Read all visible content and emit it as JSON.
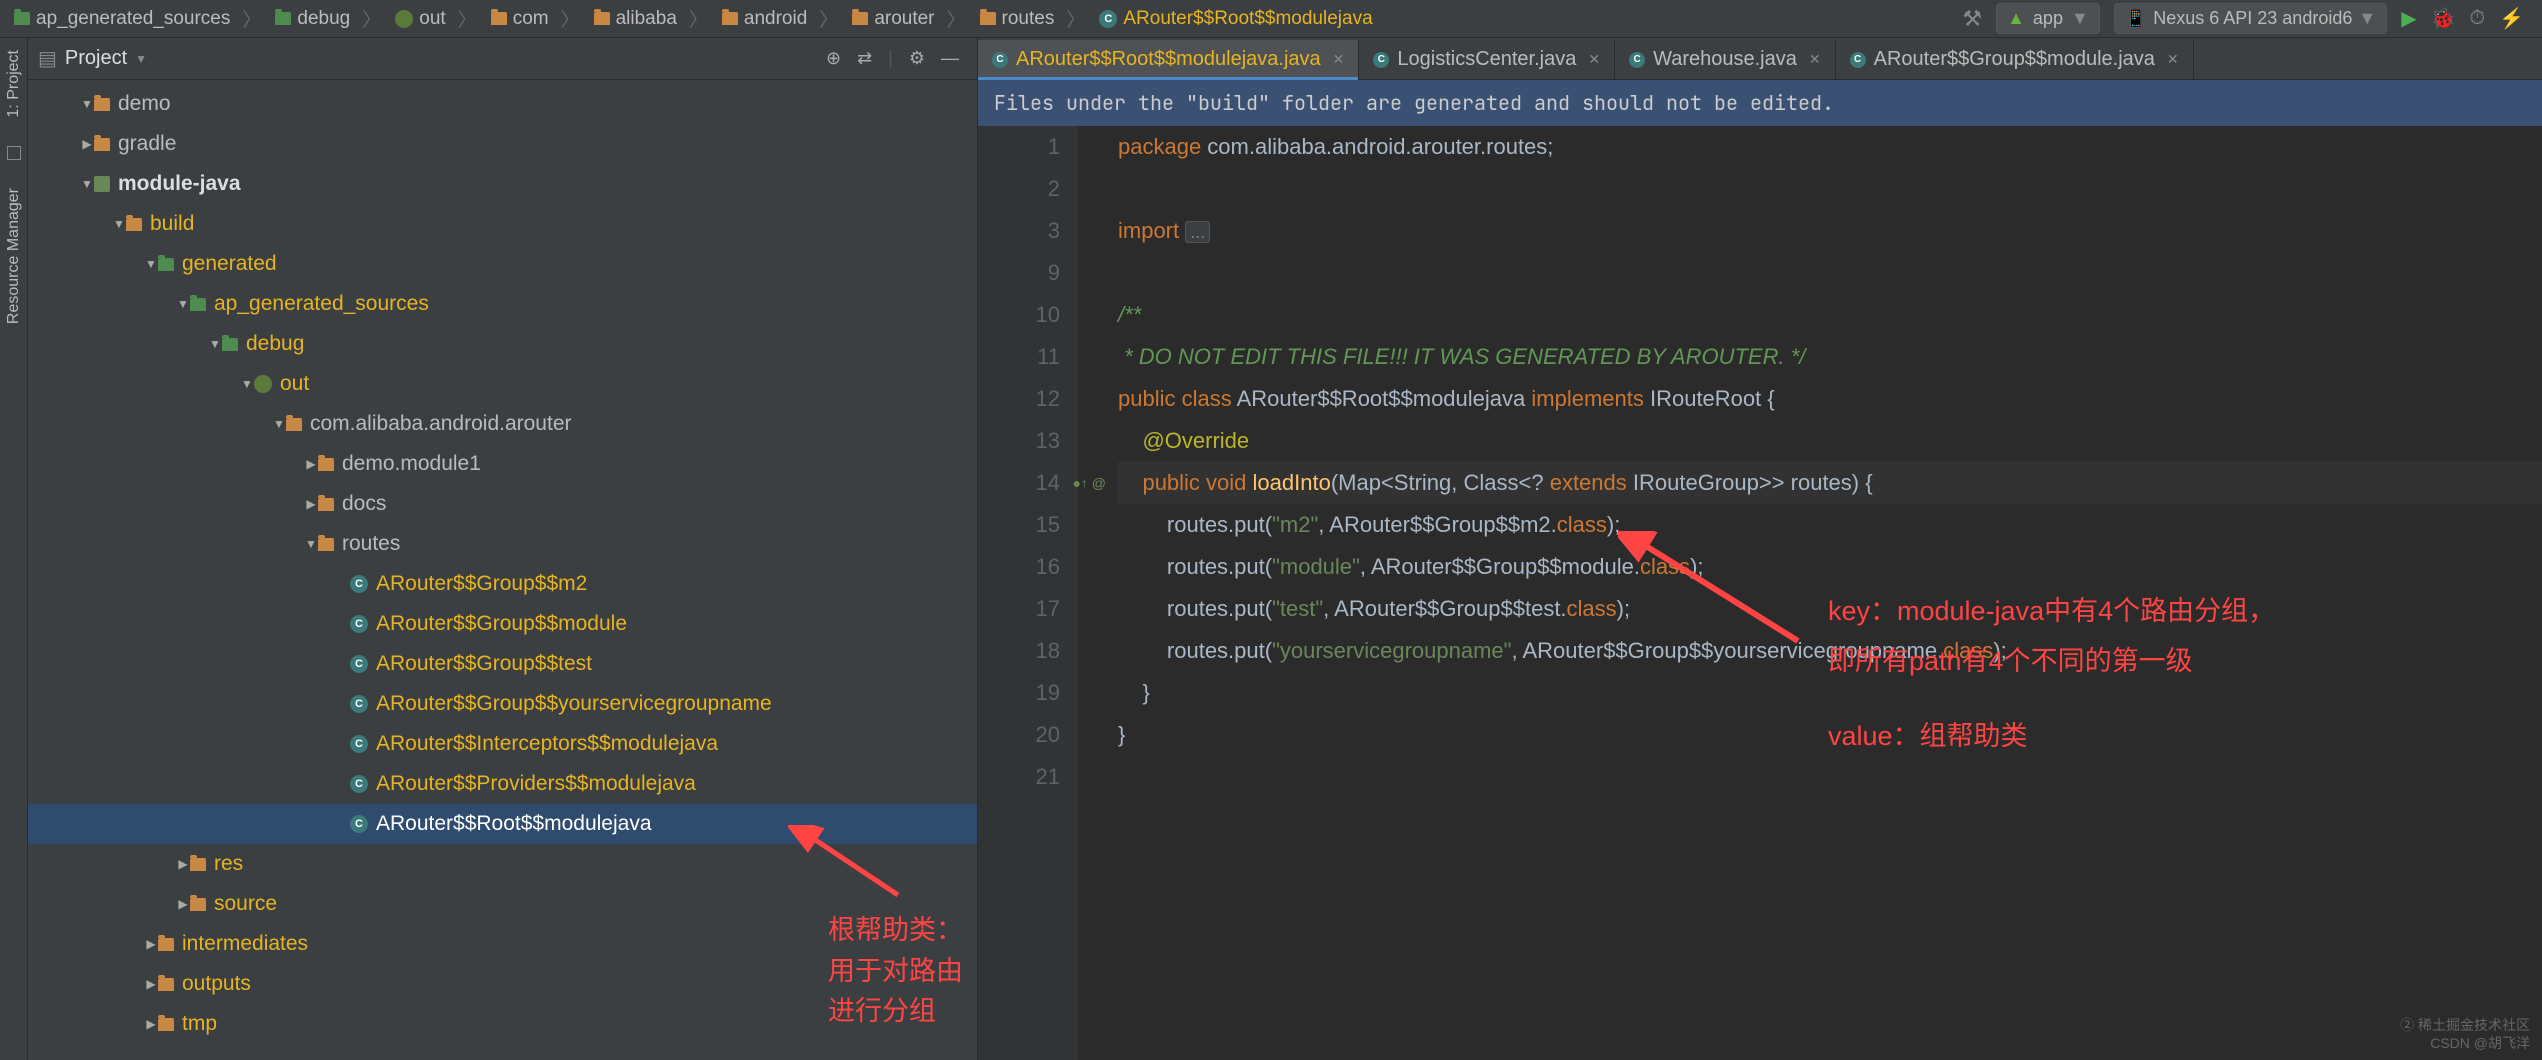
{
  "breadcrumbs": [
    {
      "icon": "folder-gen",
      "label": "ap_generated_sources"
    },
    {
      "icon": "folder-gen",
      "label": "debug"
    },
    {
      "icon": "out",
      "label": "out"
    },
    {
      "icon": "folder",
      "label": "com"
    },
    {
      "icon": "folder",
      "label": "alibaba"
    },
    {
      "icon": "folder",
      "label": "android"
    },
    {
      "icon": "folder",
      "label": "arouter"
    },
    {
      "icon": "folder",
      "label": "routes"
    },
    {
      "icon": "class",
      "label": "ARouter$$Root$$modulejava",
      "active": true
    }
  ],
  "run_config": "app",
  "device": "Nexus 6 API 23 android6",
  "project_label": "Project",
  "sidetool": {
    "top": "1: Project",
    "bottom": "Resource Manager"
  },
  "tree": [
    {
      "indent": 1,
      "arrow": "▼",
      "icon": "folder",
      "label": "demo"
    },
    {
      "indent": 1,
      "arrow": "▶",
      "icon": "folder",
      "label": "gradle"
    },
    {
      "indent": 1,
      "arrow": "▼",
      "icon": "module",
      "label": "module-java",
      "bold": true
    },
    {
      "indent": 2,
      "arrow": "▼",
      "icon": "folder",
      "label": "build",
      "hl": true
    },
    {
      "indent": 3,
      "arrow": "▼",
      "icon": "folder-gen",
      "label": "generated",
      "hl": true
    },
    {
      "indent": 4,
      "arrow": "▼",
      "icon": "folder-gen",
      "label": "ap_generated_sources",
      "hl": true
    },
    {
      "indent": 5,
      "arrow": "▼",
      "icon": "folder-gen",
      "label": "debug",
      "hl": true
    },
    {
      "indent": 6,
      "arrow": "▼",
      "icon": "out",
      "label": "out",
      "hl": true
    },
    {
      "indent": 7,
      "arrow": "▼",
      "icon": "folder",
      "label": "com.alibaba.android.arouter"
    },
    {
      "indent": 8,
      "arrow": "▶",
      "icon": "folder",
      "label": "demo.module1"
    },
    {
      "indent": 8,
      "arrow": "▶",
      "icon": "folder",
      "label": "docs"
    },
    {
      "indent": 8,
      "arrow": "▼",
      "icon": "folder",
      "label": "routes"
    },
    {
      "indent": 9,
      "arrow": "",
      "icon": "class",
      "label": "ARouter$$Group$$m2",
      "hl": true
    },
    {
      "indent": 9,
      "arrow": "",
      "icon": "class",
      "label": "ARouter$$Group$$module",
      "hl": true
    },
    {
      "indent": 9,
      "arrow": "",
      "icon": "class",
      "label": "ARouter$$Group$$test",
      "hl": true
    },
    {
      "indent": 9,
      "arrow": "",
      "icon": "class",
      "label": "ARouter$$Group$$yourservicegroupname",
      "hl": true
    },
    {
      "indent": 9,
      "arrow": "",
      "icon": "class",
      "label": "ARouter$$Interceptors$$modulejava",
      "hl": true
    },
    {
      "indent": 9,
      "arrow": "",
      "icon": "class",
      "label": "ARouter$$Providers$$modulejava",
      "hl": true
    },
    {
      "indent": 9,
      "arrow": "",
      "icon": "class",
      "label": "ARouter$$Root$$modulejava",
      "sel": true
    },
    {
      "indent": 4,
      "arrow": "▶",
      "icon": "folder",
      "label": "res",
      "hl": true
    },
    {
      "indent": 4,
      "arrow": "▶",
      "icon": "folder",
      "label": "source",
      "hl": true
    },
    {
      "indent": 3,
      "arrow": "▶",
      "icon": "folder",
      "label": "intermediates",
      "hl": true
    },
    {
      "indent": 3,
      "arrow": "▶",
      "icon": "folder",
      "label": "outputs",
      "hl": true
    },
    {
      "indent": 3,
      "arrow": "▶",
      "icon": "folder",
      "label": "tmp",
      "hl": true
    }
  ],
  "editor_tabs": [
    {
      "icon": "class",
      "label": "ARouter$$Root$$modulejava.java",
      "active": true
    },
    {
      "icon": "class",
      "label": "LogisticsCenter.java"
    },
    {
      "icon": "class",
      "label": "Warehouse.java"
    },
    {
      "icon": "class",
      "label": "ARouter$$Group$$module.java"
    }
  ],
  "banner": "Files under the \"build\" folder are generated and should not be edited.",
  "line_numbers": [
    "1",
    "2",
    "3",
    "9",
    "10",
    "11",
    "12",
    "13",
    "14",
    "15",
    "16",
    "17",
    "18",
    "19",
    "20",
    "21"
  ],
  "gutter_mark_line": "14",
  "gutter_mark": "●↑ @",
  "code": {
    "l1_kw": "package",
    "l1_rest": " com.alibaba.android.arouter.routes;",
    "l3_kw": "import ",
    "l3_fold": "...",
    "l10": "/**",
    "l11": " * DO NOT EDIT THIS FILE!!! IT WAS GENERATED BY AROUTER. */",
    "l12_a": "public class ",
    "l12_b": "ARouter$$Root$$modulejava ",
    "l12_c": "implements ",
    "l12_d": "IRouteRoot {",
    "l13": "@Override",
    "l14_a": "public void ",
    "l14_b": "loadInto",
    "l14_c": "(Map<String, Class<? ",
    "l14_d": "extends ",
    "l14_e": "IRouteGroup>> routes) {",
    "l15_a": "routes.put(",
    "l15_b": "\"m2\"",
    "l15_c": ", ARouter$$Group$$m2.",
    "l15_d": "class",
    "l15_e": ");",
    "l16_a": "routes.put(",
    "l16_b": "\"module\"",
    "l16_c": ", ARouter$$Group$$module.",
    "l16_d": "class",
    "l16_e": ");",
    "l17_a": "routes.put(",
    "l17_b": "\"test\"",
    "l17_c": ", ARouter$$Group$$test.",
    "l17_d": "class",
    "l17_e": ");",
    "l18_a": "routes.put(",
    "l18_b": "\"yourservicegroupname\"",
    "l18_c": ", ARouter$$Group$$yourservicegroupname.",
    "l18_d": "class",
    "l18_e": ");",
    "l19": "}",
    "l20": "}"
  },
  "annotations": {
    "left": "根帮助类：用于对路由进行分组",
    "right1": "key：module-java中有4个路由分组，",
    "right2": "即所有path有4个不同的第一级",
    "right3": "value：组帮助类"
  },
  "watermark": {
    "a": "② 稀土掘金技术社区",
    "b": "CSDN @胡飞洋"
  }
}
